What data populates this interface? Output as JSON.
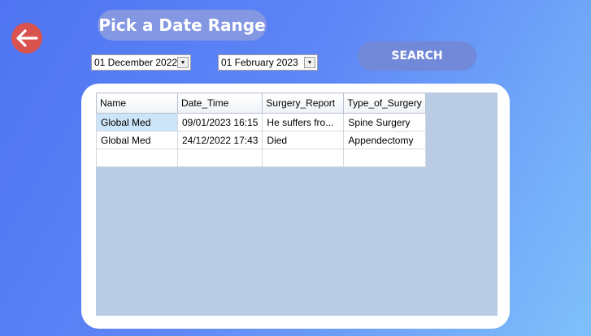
{
  "header": {
    "title": "Pick a Date Range",
    "back_icon": "arrow-left-icon"
  },
  "filters": {
    "start_date": "01 December 2022",
    "end_date": "01 February 2023",
    "search_label": "SEARCH"
  },
  "colors": {
    "back_button": "#d9534f",
    "title_pill": "#8497e2",
    "search_button": "#7189d8",
    "grid_background": "#b9cce4",
    "selected_cell": "#cce4f7"
  },
  "table": {
    "columns": [
      "Name",
      "Date_Time",
      "Surgery_Report",
      "Type_of_Surgery"
    ],
    "rows": [
      [
        "Global Med",
        "09/01/2023 16:15",
        "He suffers fro...",
        "Spine Surgery"
      ],
      [
        "Global Med",
        "24/12/2022 17:43",
        "Died",
        "Appendectomy"
      ],
      [
        "",
        "",
        "",
        ""
      ]
    ]
  }
}
